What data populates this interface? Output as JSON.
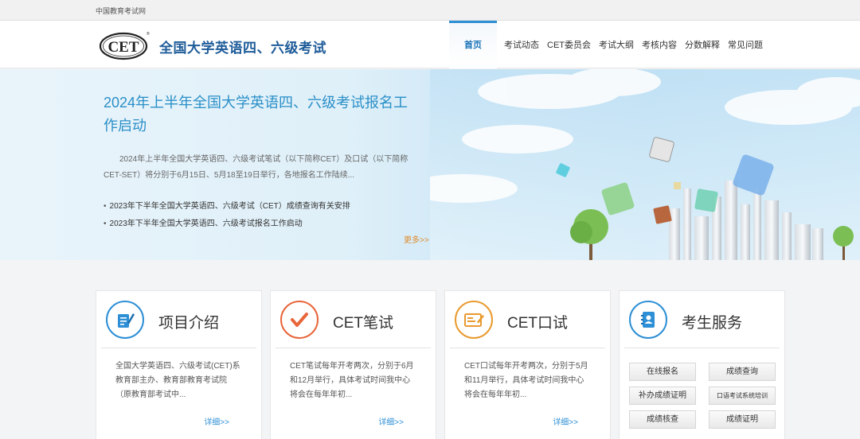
{
  "topbar": {
    "portal_link": "中国教育考试网"
  },
  "header": {
    "logo_text": "CET",
    "site_title": "全国大学英语四、六级考试"
  },
  "nav": {
    "items": [
      "首页",
      "考试动态",
      "CET委员会",
      "考试大纲",
      "考核内容",
      "分数解释",
      "常见问题"
    ]
  },
  "banner": {
    "headline": "2024年上半年全国大学英语四、六级考试报名工作启动",
    "summary": "2024年上半年全国大学英语四、六级考试笔试（以下简称CET）及口试（以下简称CET-SET）将分别于6月15日、5月18至19日举行，各地报名工作陆续...",
    "news": [
      "2023年下半年全国大学英语四、六级考试（CET）成绩查询有关安排",
      "2023年下半年全国大学英语四、六级考试报名工作启动"
    ],
    "more_label": "更多>>"
  },
  "cards": [
    {
      "title": "项目介绍",
      "icon": "document-edit-icon",
      "color": "#2d8fd5",
      "body": "全国大学英语四、六级考试(CET)系教育部主办、教育部教育考试院（原教育部考试中...",
      "detail": "详细>>"
    },
    {
      "title": "CET笔试",
      "icon": "checkmark-icon",
      "color": "#e8653a",
      "body": "CET笔试每年开考两次，分别于6月和12月举行，具体考试时间我中心将会在每年年初...",
      "detail": "详细>>"
    },
    {
      "title": "CET口试",
      "icon": "id-card-icon",
      "color": "#e99a2f",
      "body": "CET口试每年开考两次，分别于5月和11月举行，具体考试时间我中心将会在每年年初...",
      "detail": "详细>>"
    }
  ],
  "services": {
    "title": "考生服务",
    "icon": "address-book-icon",
    "color": "#2d8fd5",
    "buttons": [
      "在线报名",
      "成绩查询",
      "补办成绩证明",
      "口语考试系统培训",
      "成绩核查",
      "成绩证明"
    ]
  }
}
